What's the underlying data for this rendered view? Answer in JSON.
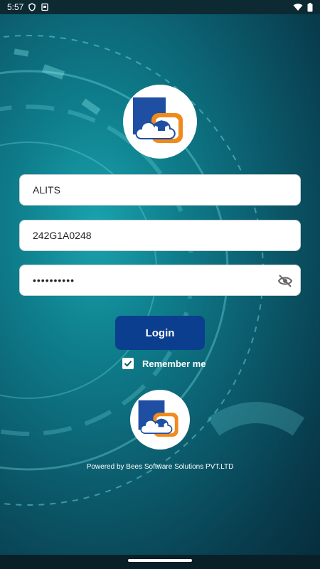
{
  "status_bar": {
    "time": "5:57",
    "icons": [
      "shield-icon",
      "sim-card-icon",
      "wifi-icon",
      "battery-icon"
    ]
  },
  "form": {
    "institution_value": "ALITS",
    "username_value": "242G1A0248",
    "password_value": "••••••••••",
    "password_visibility_icon": "eye-off-icon"
  },
  "login_button_label": "Login",
  "remember_me": {
    "label": "Remember me",
    "checked": true
  },
  "footer": {
    "powered_by": "Powered by Bees Software Solutions PVT.LTD"
  },
  "colors": {
    "primary_button": "#0b3e8e",
    "logo_blue": "#1f4fa3",
    "logo_orange": "#f08a1c"
  }
}
